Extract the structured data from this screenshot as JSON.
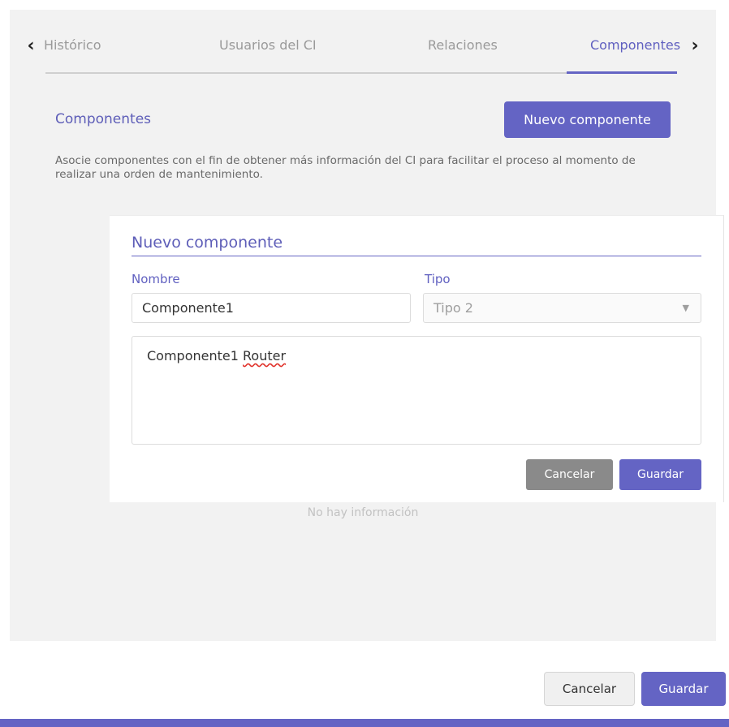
{
  "tabs": {
    "items": [
      {
        "label": "Histórico"
      },
      {
        "label": "Usuarios del CI"
      },
      {
        "label": "Relaciones"
      },
      {
        "label": "Componentes",
        "active": true
      }
    ],
    "prev_icon": "chevron-left-icon",
    "next_icon": "chevron-right-icon"
  },
  "section": {
    "title": "Componentes",
    "new_button": "Nuevo componente",
    "description": "Asocie componentes con el fin de obtener más información del CI para facilitar el proceso al momento de realizar una orden de mantenimiento.",
    "empty_message": "No hay información"
  },
  "form": {
    "title": "Nuevo componente",
    "name_label": "Nombre",
    "name_value": "Componente1",
    "type_label": "Tipo",
    "type_value": "Tipo 2",
    "description_text_1": "Componente1 ",
    "description_text_2": "Router",
    "cancel_label": "Cancelar",
    "save_label": "Guardar"
  },
  "footer": {
    "cancel_label": "Cancelar",
    "save_label": "Guardar"
  },
  "colors": {
    "accent": "#6464c4",
    "panel_bg": "#f2f2f2",
    "muted_button": "#8a8a8a"
  }
}
